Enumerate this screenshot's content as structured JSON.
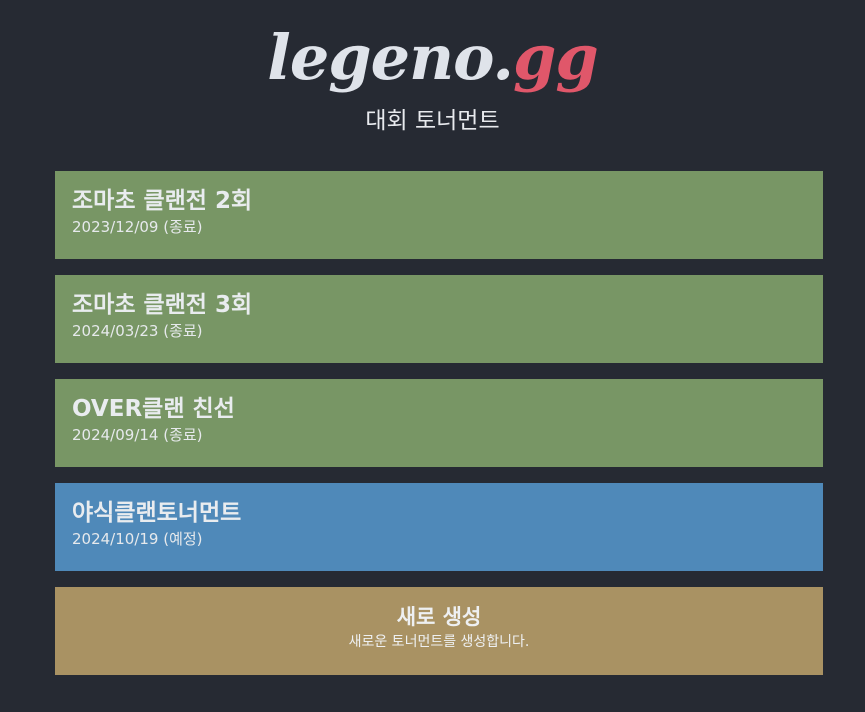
{
  "brand": {
    "logo_main": "legeno",
    "logo_dot": ".",
    "logo_tld": "gg",
    "subtitle": "대회 토너먼트"
  },
  "tournaments": [
    {
      "title": "조마초 클랜전 2회",
      "date": "2023/12/09 (종료)",
      "status": "done"
    },
    {
      "title": "조마초 클랜전 3회",
      "date": "2024/03/23 (종료)",
      "status": "done"
    },
    {
      "title": "OVER클랜 친선",
      "date": "2024/09/14 (종료)",
      "status": "done"
    },
    {
      "title": "야식클랜토너먼트",
      "date": "2024/10/19 (예정)",
      "status": "planned"
    }
  ],
  "create": {
    "title": "새로 생성",
    "description": "새로운 토너먼트를 생성합니다."
  },
  "colors": {
    "background": "#262a33",
    "done": "#789665",
    "planned": "#4f89b9",
    "create": "#a99263",
    "logo_accent": "#e0576a"
  }
}
